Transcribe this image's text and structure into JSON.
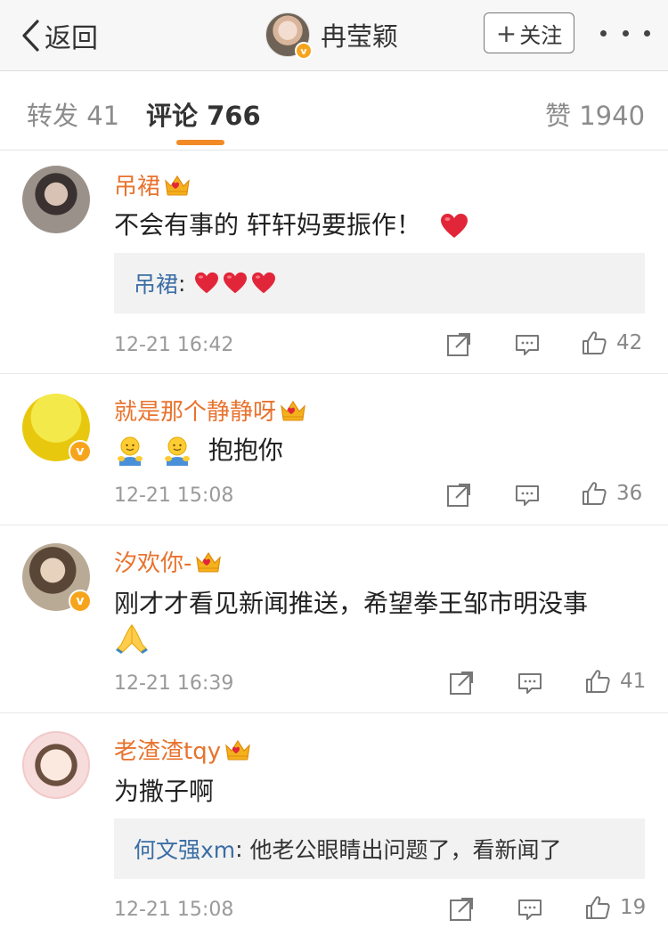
{
  "nav": {
    "back_label": "返回",
    "profile_name": "冉莹颖",
    "verified_mark": "v",
    "follow_label": "关注",
    "follow_plus": "+"
  },
  "tabs": {
    "repost": "转发 41",
    "comments": "评论 766",
    "likes": "赞 1940"
  },
  "colors": {
    "accent": "#f28a25",
    "username": "#e8732e",
    "reply_user": "#3b6ea5",
    "timestamp": "#9a9a9a",
    "verified_badge": "#f7a41d"
  },
  "comments": [
    {
      "name": "吊裙",
      "text": "不会有事的 轩轩妈要振作！",
      "text_emoji": "heart",
      "reply": {
        "user": "吊裙",
        "sep": ":",
        "text": "",
        "emoji": [
          "heart",
          "heart",
          "heart"
        ]
      },
      "time": "12-21 16:42",
      "likes": "42",
      "verified": false,
      "badge_icon": "crown-icon"
    },
    {
      "name": "就是那个静静呀",
      "text": "抱抱你",
      "text_emoji_prefix": [
        "hug",
        "hug"
      ],
      "time": "12-21 15:08",
      "likes": "36",
      "verified": true,
      "verified_mark": "v",
      "badge_icon": "crown-icon"
    },
    {
      "name": "汐欢你-",
      "text": "刚才才看见新闻推送，希望拳王邹市明没事",
      "text_emoji_line2": "pray",
      "time": "12-21 16:39",
      "likes": "41",
      "verified": true,
      "verified_mark": "v",
      "badge_icon": "crown-icon"
    },
    {
      "name": "老渣渣tqy",
      "text": "为撒子啊",
      "reply": {
        "user": "何文强xm",
        "sep": ":",
        "text": " 他老公眼睛出问题了，看新闻了"
      },
      "time": "12-21 15:08",
      "likes": "19",
      "verified": false,
      "badge_icon": "crown-icon"
    }
  ]
}
